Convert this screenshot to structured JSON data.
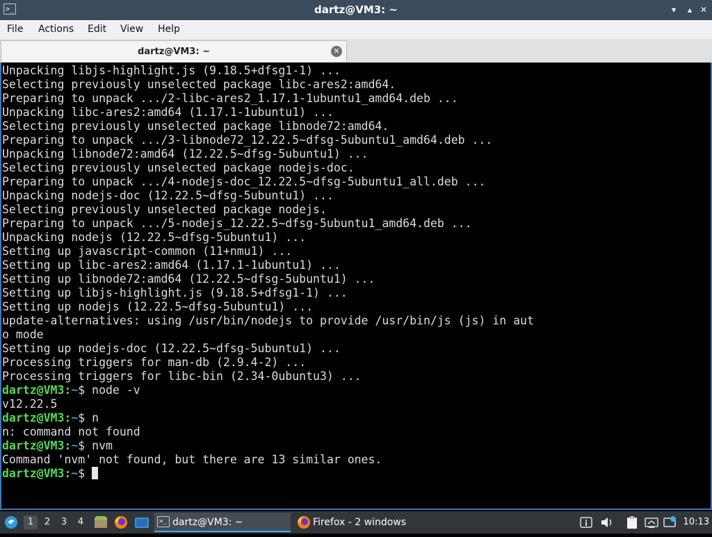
{
  "window": {
    "title": "dartz@VM3: ~",
    "icon": "terminal-icon",
    "buttons": [
      "minimize",
      "maximize",
      "close"
    ]
  },
  "menu": [
    "File",
    "Actions",
    "Edit",
    "View",
    "Help"
  ],
  "tab": {
    "label": "dartz@VM3: ~",
    "close_icon": "close-circle-icon"
  },
  "prompt": {
    "user_host": "dartz@VM3",
    "sep": ":",
    "path": "~",
    "dollar": "$"
  },
  "terminal": {
    "output_lines": [
      "Unpacking libjs-highlight.js (9.18.5+dfsg1-1) ...",
      "Selecting previously unselected package libc-ares2:amd64.",
      "Preparing to unpack .../2-libc-ares2_1.17.1-1ubuntu1_amd64.deb ...",
      "Unpacking libc-ares2:amd64 (1.17.1-1ubuntu1) ...",
      "Selecting previously unselected package libnode72:amd64.",
      "Preparing to unpack .../3-libnode72_12.22.5~dfsg-5ubuntu1_amd64.deb ...",
      "Unpacking libnode72:amd64 (12.22.5~dfsg-5ubuntu1) ...",
      "Selecting previously unselected package nodejs-doc.",
      "Preparing to unpack .../4-nodejs-doc_12.22.5~dfsg-5ubuntu1_all.deb ...",
      "Unpacking nodejs-doc (12.22.5~dfsg-5ubuntu1) ...",
      "Selecting previously unselected package nodejs.",
      "Preparing to unpack .../5-nodejs_12.22.5~dfsg-5ubuntu1_amd64.deb ...",
      "Unpacking nodejs (12.22.5~dfsg-5ubuntu1) ...",
      "Setting up javascript-common (11+nmu1) ...",
      "Setting up libc-ares2:amd64 (1.17.1-1ubuntu1) ...",
      "Setting up libnode72:amd64 (12.22.5~dfsg-5ubuntu1) ...",
      "Setting up libjs-highlight.js (9.18.5+dfsg1-1) ...",
      "Setting up nodejs (12.22.5~dfsg-5ubuntu1) ...",
      "update-alternatives: using /usr/bin/nodejs to provide /usr/bin/js (js) in aut",
      "o mode",
      "Setting up nodejs-doc (12.22.5~dfsg-5ubuntu1) ...",
      "Processing triggers for man-db (2.9.4-2) ...",
      "Processing triggers for libc-bin (2.34-0ubuntu3) ..."
    ],
    "session": [
      {
        "command": "node -v",
        "output": "v12.22.5"
      },
      {
        "command": "n",
        "output": "n: command not found"
      },
      {
        "command": "nvm",
        "output": "Command 'nvm' not found, but there are 13 similar ones."
      }
    ]
  },
  "taskbar": {
    "workspaces": [
      "1",
      "2",
      "3",
      "4"
    ],
    "active_workspace": "1",
    "launchers": [
      "app-menu-icon",
      "file-manager-icon",
      "firefox-icon",
      "show-desktop-icon"
    ],
    "tasks": [
      {
        "label": "dartz@VM3: ~",
        "icon": "terminal-icon",
        "active": true
      },
      {
        "label": "Firefox - 2 windows",
        "icon": "firefox-icon",
        "active": false
      }
    ],
    "tray": [
      "info-icon",
      "volume-icon",
      "clipboard-icon",
      "network-icon",
      "update-icon"
    ],
    "clock": "10:13"
  },
  "colors": {
    "titlebar": "#394b5c",
    "prompt_user": "#54d954",
    "prompt_path": "#5a8ed0",
    "taskbar": "#31363b",
    "accent": "#3daee9"
  }
}
